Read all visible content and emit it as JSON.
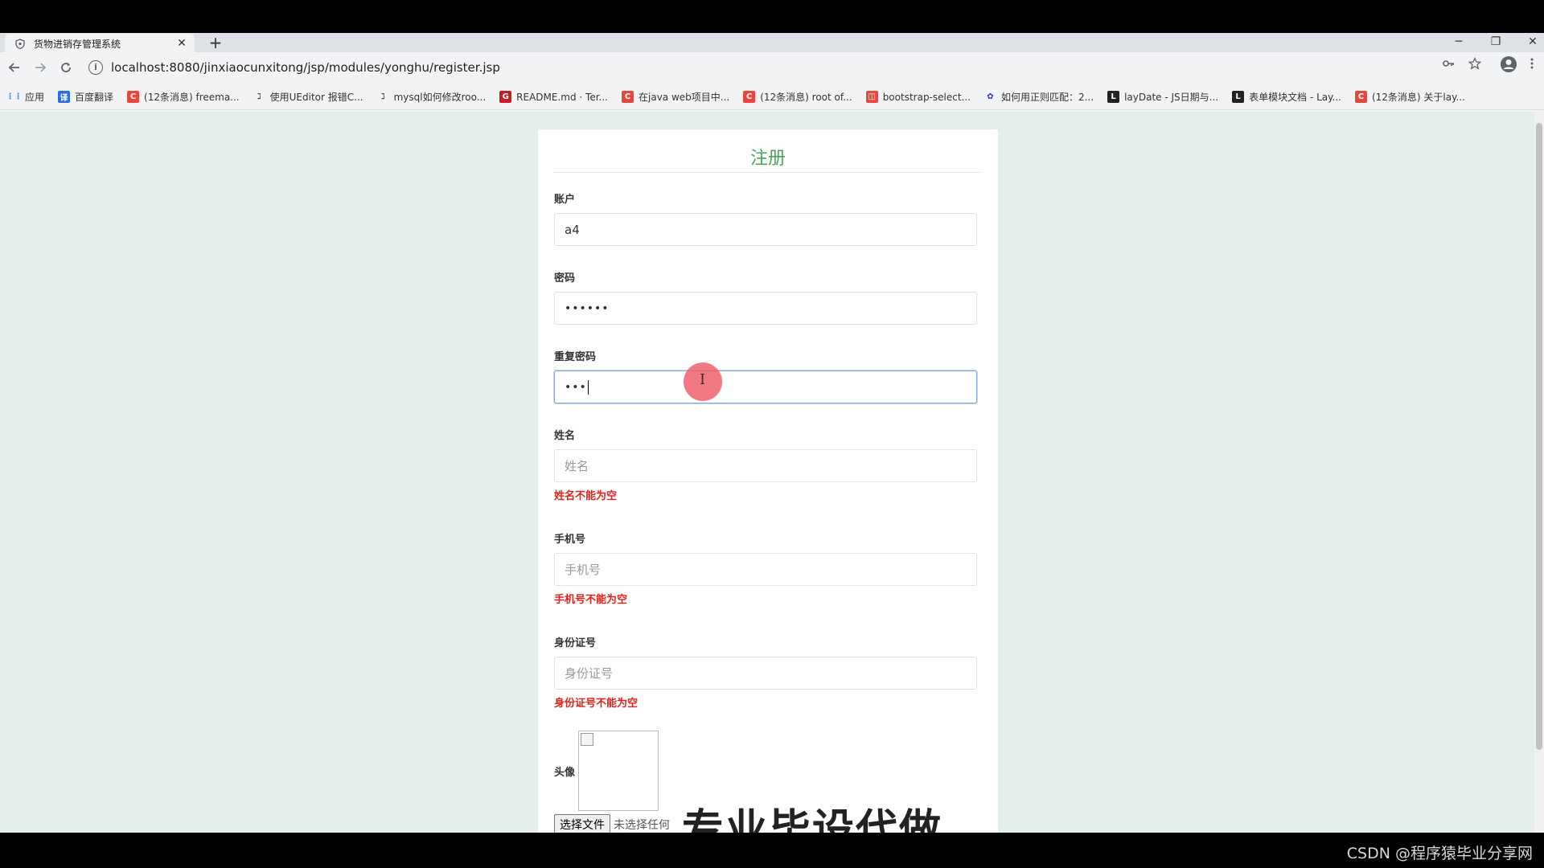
{
  "browser": {
    "tab_title": "货物进销存管理系统",
    "tab_close": "✕",
    "new_tab": "+",
    "url": "localhost:8080/jinxiaocunxitong/jsp/modules/yonghu/register.jsp",
    "window_controls": {
      "minimize": "─",
      "restore": "❐",
      "close": "✕"
    }
  },
  "bookmarks": [
    {
      "label": "应用",
      "icon": "apps-grid-icon",
      "color": "#1a73e8"
    },
    {
      "label": "百度翻译",
      "icon": "baidu-translate-icon",
      "color": "#2b6cde"
    },
    {
      "label": "(12条消息) freema...",
      "icon": "csdn-icon",
      "color": "#e8473a"
    },
    {
      "label": "使用UEditor 报错C...",
      "icon": "ueditor-icon",
      "color": "#444444"
    },
    {
      "label": "mysql如何修改roo...",
      "icon": "ueditor-icon",
      "color": "#444444"
    },
    {
      "label": "README.md · Ter...",
      "icon": "gitee-icon",
      "color": "#c71d23"
    },
    {
      "label": "在java web项目中...",
      "icon": "csdn-icon",
      "color": "#e8473a"
    },
    {
      "label": "(12条消息) root of...",
      "icon": "csdn-icon",
      "color": "#e8473a"
    },
    {
      "label": "bootstrap-select...",
      "icon": "oschina-icon",
      "color": "#e8473a"
    },
    {
      "label": "如何用正则匹配：2...",
      "icon": "baidu-paw-icon",
      "color": "#2932e1"
    },
    {
      "label": "layDate - JS日期与...",
      "icon": "layui-icon",
      "color": "#222222"
    },
    {
      "label": "表单模块文档 - Lay...",
      "icon": "layui-icon",
      "color": "#222222"
    },
    {
      "label": "(12条消息) 关于lay...",
      "icon": "csdn-icon",
      "color": "#e8473a"
    }
  ],
  "form": {
    "title": "注册",
    "account": {
      "label": "账户",
      "value": "a4"
    },
    "password": {
      "label": "密码",
      "value": "••••••"
    },
    "repeat_password": {
      "label": "重复密码",
      "value": "•••"
    },
    "name": {
      "label": "姓名",
      "placeholder": "姓名",
      "error": "姓名不能为空"
    },
    "phone": {
      "label": "手机号",
      "placeholder": "手机号",
      "error": "手机号不能为空"
    },
    "id_card": {
      "label": "身份证号",
      "placeholder": "身份证号",
      "error": "身份证号不能为空"
    },
    "avatar": {
      "label": "头像",
      "file_button": "选择文件",
      "file_status": "未选择任何"
    }
  },
  "overlay_text": "专业毕设代做",
  "watermark": "CSDN @程序猿毕业分享网",
  "colors": {
    "accent": "#4aa35a",
    "error": "#e0201b",
    "page_bg": "#e4efea"
  }
}
